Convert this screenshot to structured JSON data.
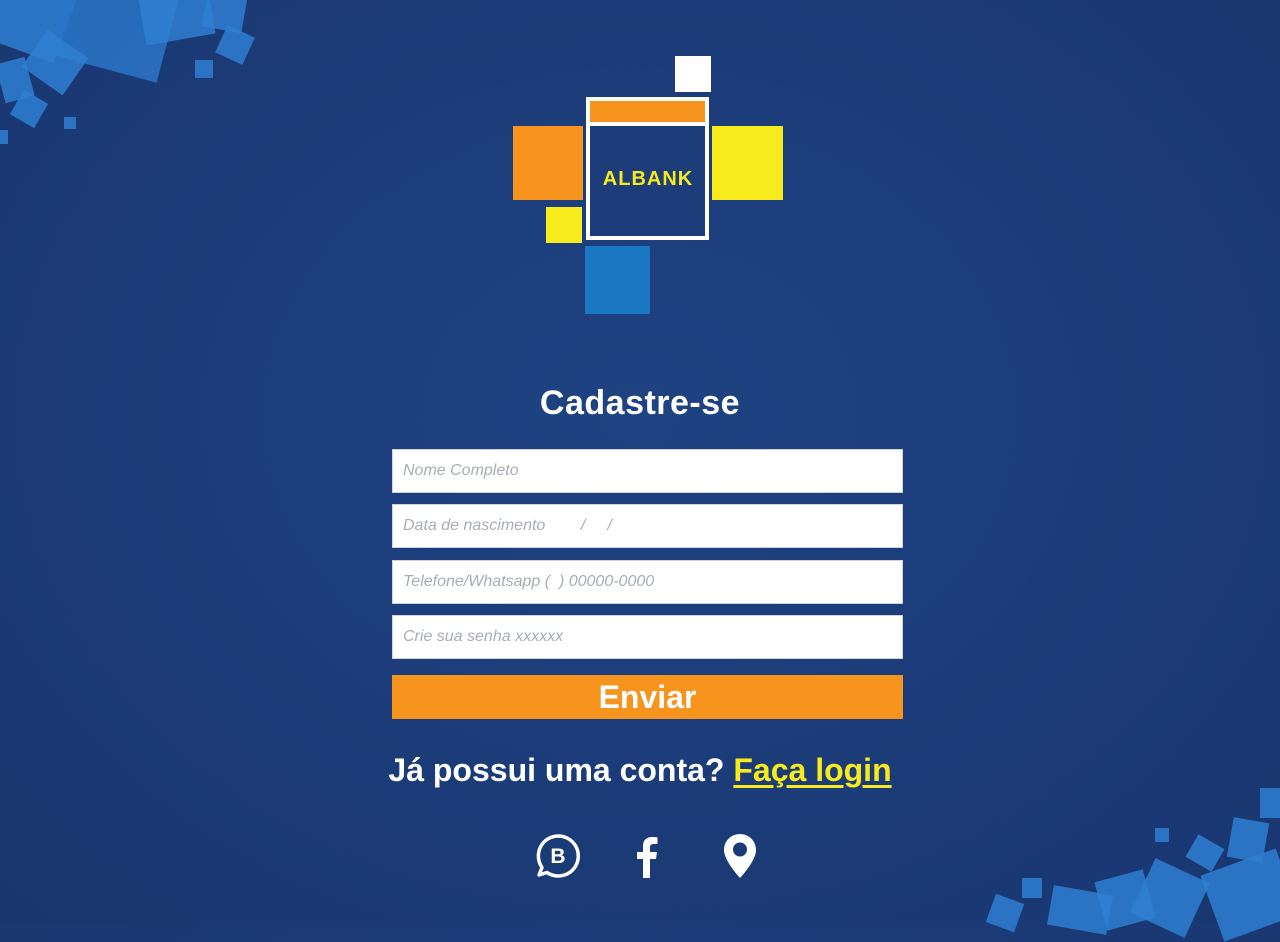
{
  "brand": {
    "name": "ALBANK",
    "colors": {
      "orange": "#f7941d",
      "yellow": "#f7ea1d",
      "navy": "#1c3d7a",
      "blue": "#1a78c2",
      "white": "#ffffff"
    }
  },
  "form": {
    "title": "Cadastre-se",
    "fields": [
      {
        "name": "nome",
        "placeholder": "Nome Completo"
      },
      {
        "name": "nascimento",
        "placeholder": "Data de nascimento        /     /"
      },
      {
        "name": "telefone",
        "placeholder": "Telefone/Whatsapp (  ) 00000-0000"
      },
      {
        "name": "senha",
        "placeholder": "Crie sua senha xxxxxx"
      }
    ],
    "submit_label": "Enviar"
  },
  "login": {
    "prompt": "Já possui uma conta?",
    "link_label": "Faça login"
  },
  "social": [
    {
      "icon": "whatsapp-business-icon",
      "glyph": "B"
    },
    {
      "icon": "facebook-icon"
    },
    {
      "icon": "location-pin-icon"
    }
  ]
}
